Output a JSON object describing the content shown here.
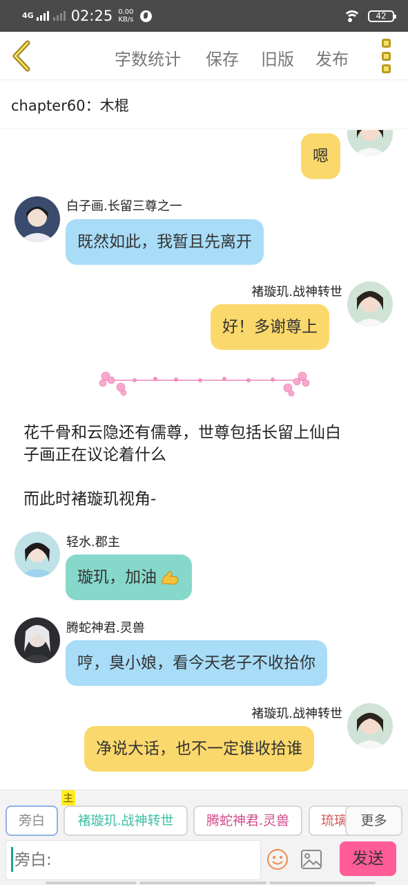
{
  "status_bar": {
    "network": "4G",
    "time": "02:25",
    "speed_value": "0.00",
    "speed_unit": "KB/s",
    "battery": "42",
    "icons": [
      "signal-icon",
      "globe-icon",
      "wifi-icon",
      "battery-icon"
    ]
  },
  "toolbar": {
    "back_icon": "chevron-left-icon",
    "word_count": "字数统计",
    "save": "保存",
    "old_version": "旧版",
    "publish": "发布",
    "menu_icon": "more-vertical-icon"
  },
  "chapter": {
    "title": "chapter60：木棍"
  },
  "messages": [
    {
      "side": "right",
      "name": "",
      "text": "嗯",
      "color": "yellow",
      "avatar": "avatar-chuxuanji"
    },
    {
      "side": "left",
      "name": "白子画.长留三尊之一",
      "text": "既然如此，我暂且先离开",
      "color": "blue",
      "avatar": "avatar-baizihua"
    },
    {
      "side": "right",
      "name": "褚璇玑.战神转世",
      "text": "好！多谢尊上",
      "color": "yellow",
      "avatar": "avatar-chuxuanji"
    },
    {
      "type": "divider",
      "icon": "flower-divider-icon"
    },
    {
      "type": "narration",
      "lines": [
        "花千骨和云隐还有儒尊，世尊包括长留上仙白",
        "子画正在议论着什么"
      ]
    },
    {
      "type": "narration",
      "text": "而此时褚璇玑视角-"
    },
    {
      "side": "left",
      "name": "轻水.郡主",
      "text": "璇玑，加油",
      "emoji": "flexed-biceps-icon",
      "color": "teal",
      "avatar": "avatar-qingshui"
    },
    {
      "side": "left",
      "name": "腾蛇神君.灵兽",
      "text": "哼，臭小娘，看今天老子不收拾你",
      "color": "blue",
      "avatar": "avatar-tengshe"
    },
    {
      "side": "right",
      "name": "褚璇玑.战神转世",
      "text": "净说大话，也不一定谁收拾谁",
      "color": "yellow",
      "avatar": "avatar-chuxuanji"
    }
  ],
  "composer": {
    "main_tag": "主",
    "roles": [
      {
        "label": "旁白",
        "style": "selected"
      },
      {
        "label": "褚璇玑.战神转世",
        "style": "teal"
      },
      {
        "label": "腾蛇神君.灵兽",
        "style": "pink"
      },
      {
        "label": "琉璃",
        "style": "red"
      }
    ],
    "more": "更多",
    "input_placeholder": "旁白:",
    "emoji_icon": "smiley-icon",
    "image_icon": "image-icon",
    "send": "发送"
  },
  "colors": {
    "bubble_blue": "#a8dcf7",
    "bubble_yellow": "#fad86b",
    "bubble_teal": "#86d8ca",
    "send_button": "#ff5c98",
    "status_bar": "#4a4a4a"
  }
}
